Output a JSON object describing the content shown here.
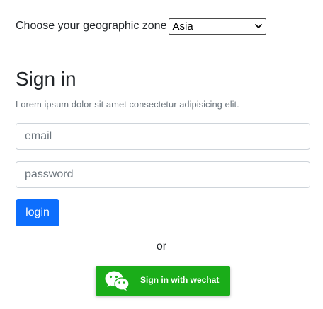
{
  "zone": {
    "label": "Choose your geographic zone",
    "selected": "Asia"
  },
  "signin": {
    "title": "Sign in",
    "subtitle": "Lorem ipsum dolor sit amet consectetur adipisicing elit.",
    "email_placeholder": "email",
    "password_placeholder": "password",
    "login_label": "login",
    "or_label": "or",
    "wechat_label": "Sign in with wechat"
  },
  "icons": {
    "select_arrow": "chevron-down-icon",
    "wechat": "wechat-icon"
  },
  "colors": {
    "primary": "#0d6efd",
    "wechat_green": "#1aad19",
    "muted_text": "#6c757d"
  }
}
